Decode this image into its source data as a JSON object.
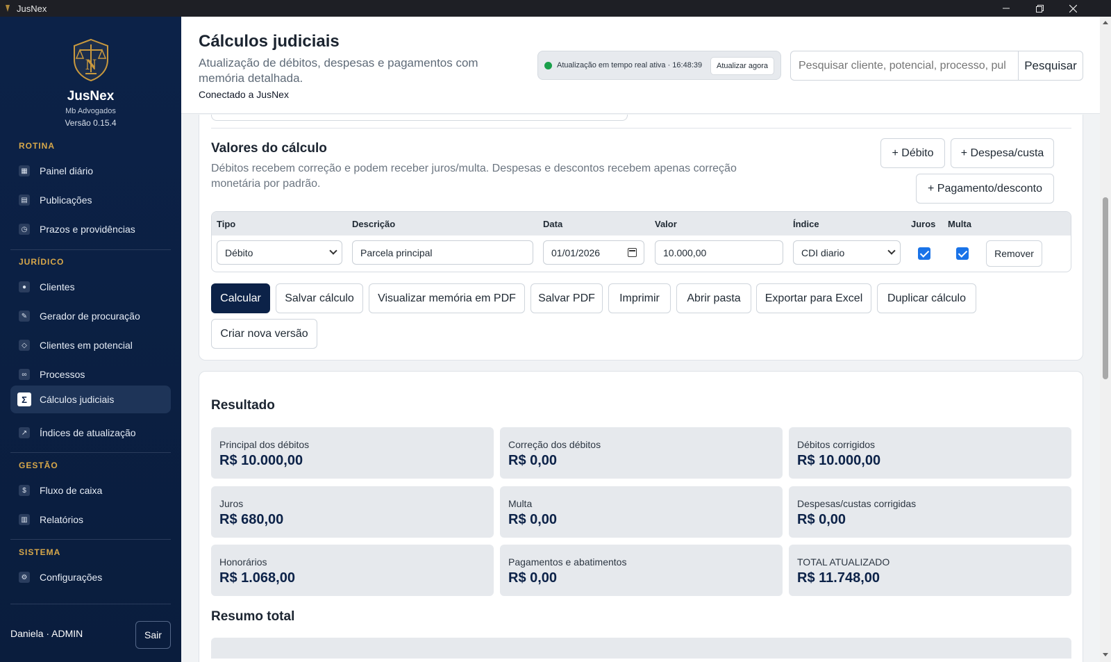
{
  "window": {
    "title": "JusNex"
  },
  "brand": {
    "name": "JusNex",
    "office": "Mb Advogados",
    "version": "Versão 0.15.4"
  },
  "sidebar": {
    "sections": [
      {
        "title": "ROTINA"
      },
      {
        "title": "JURÍDICO"
      },
      {
        "title": "GESTÃO"
      },
      {
        "title": "SISTEMA"
      }
    ],
    "items": [
      {
        "label": "Painel diário",
        "icon": "dashboard-icon"
      },
      {
        "label": "Publicações",
        "icon": "newspaper-icon"
      },
      {
        "label": "Prazos e providências",
        "icon": "clock-icon"
      },
      {
        "label": "Clientes",
        "icon": "person-icon"
      },
      {
        "label": "Gerador de procuração",
        "icon": "pen-icon"
      },
      {
        "label": "Clientes em potencial",
        "icon": "diamond-icon"
      },
      {
        "label": "Processos",
        "icon": "binoculars-icon"
      },
      {
        "label": "Cálculos judiciais",
        "icon": "sigma-icon",
        "active": true
      },
      {
        "label": "Índices de atualização",
        "icon": "trend-arrow-icon"
      },
      {
        "label": "Fluxo de caixa",
        "icon": "dollar-icon"
      },
      {
        "label": "Relatórios",
        "icon": "report-icon"
      },
      {
        "label": "Configurações",
        "icon": "gear-icon"
      }
    ],
    "user": "Daniela · ADMIN",
    "logout_label": "Sair"
  },
  "header": {
    "title": "Cálculos judiciais",
    "subtitle": "Atualização de débitos, despesas e pagamentos com memória detalhada.",
    "connection": "Conectado a JusNex",
    "realtime_status": "Atualização em tempo real ativa · 16:48:39",
    "refresh_label": "Atualizar agora",
    "search_placeholder": "Pesquisar cliente, potencial, processo, pul",
    "search_button": "Pesquisar"
  },
  "values_section": {
    "title": "Valores do cálculo",
    "description": "Débitos recebem correção e podem receber juros/multa. Despesas e descontos recebem apenas correção monetária por padrão.",
    "add_debit": "+ Débito",
    "add_expense": "+ Despesa/custa",
    "add_payment": "+ Pagamento/desconto",
    "columns": [
      "Tipo",
      "Descrição",
      "Data",
      "Valor",
      "Índice",
      "Juros",
      "Multa"
    ],
    "rows": [
      {
        "tipo": "Débito",
        "descricao": "Parcela principal",
        "data": "01/01/2026",
        "valor": "10.000,00",
        "indice": "CDI diario",
        "juros": true,
        "multa": true,
        "remove_label": "Remover"
      }
    ]
  },
  "actions": [
    "Calcular",
    "Salvar cálculo",
    "Visualizar memória em PDF",
    "Salvar PDF",
    "Imprimir",
    "Abrir pasta",
    "Exportar para Excel",
    "Duplicar cálculo",
    "Criar nova versão"
  ],
  "result": {
    "title": "Resultado",
    "items": [
      {
        "label": "Principal dos débitos",
        "value": "R$ 10.000,00"
      },
      {
        "label": "Correção dos débitos",
        "value": "R$ 0,00"
      },
      {
        "label": "Débitos corrigidos",
        "value": "R$ 10.000,00"
      },
      {
        "label": "Juros",
        "value": "R$ 680,00"
      },
      {
        "label": "Multa",
        "value": "R$ 0,00"
      },
      {
        "label": "Despesas/custas corrigidas",
        "value": "R$ 0,00"
      },
      {
        "label": "Honorários",
        "value": "R$ 1.068,00"
      },
      {
        "label": "Pagamentos e abatimentos",
        "value": "R$ 0,00"
      },
      {
        "label": "TOTAL ATUALIZADO",
        "value": "R$ 11.748,00"
      }
    ],
    "summary_title": "Resumo total"
  },
  "colors": {
    "sidebar_bg": "#0c2248",
    "accent_gold": "#d8a84a",
    "primary": "#0c2248",
    "status_green": "#1aa04b",
    "checkbox_blue": "#1a73e8"
  }
}
